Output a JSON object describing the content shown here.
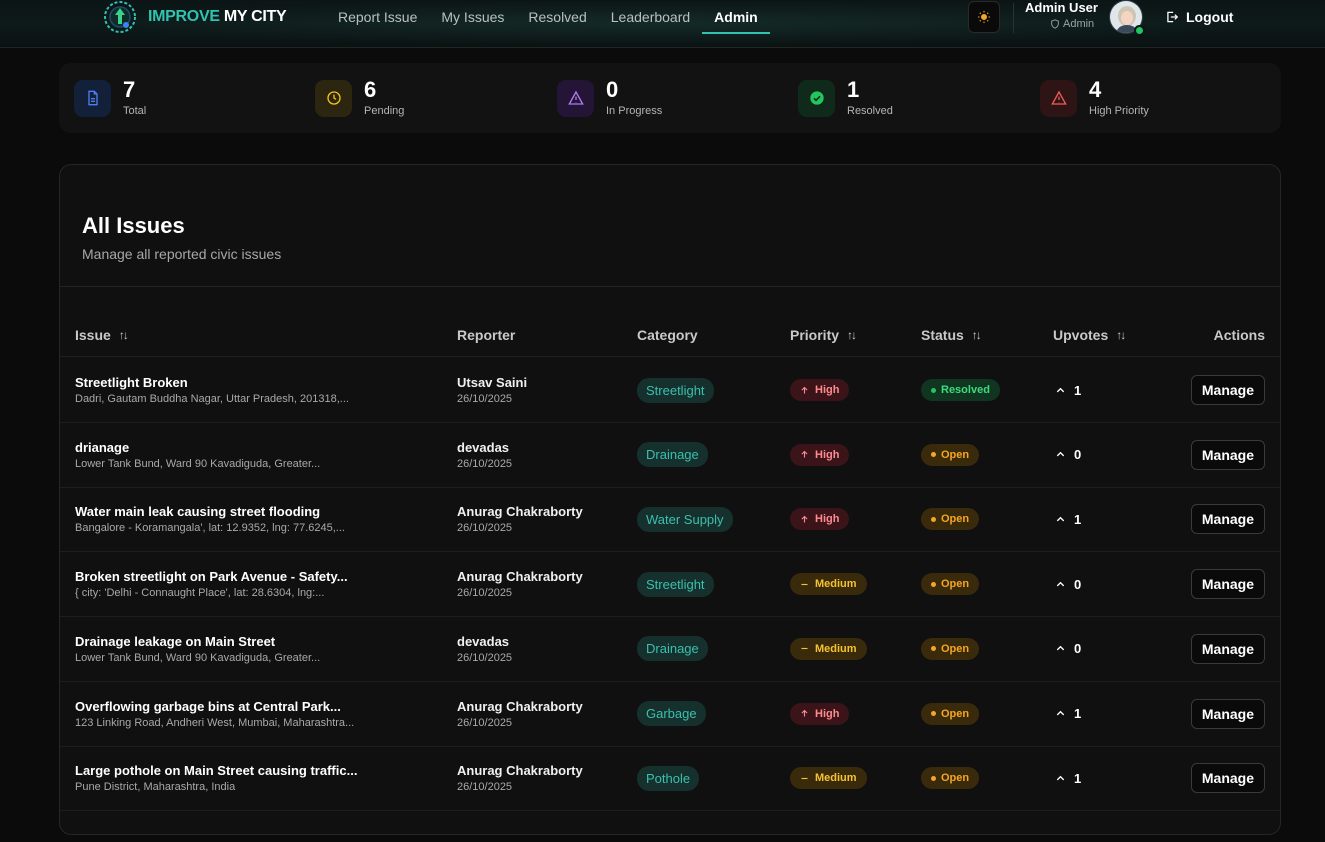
{
  "header": {
    "logo_part1": "IMPROVE",
    "logo_part2": " MY CITY",
    "nav": [
      {
        "label": "Report Issue"
      },
      {
        "label": "My Issues"
      },
      {
        "label": "Resolved"
      },
      {
        "label": "Leaderboard"
      },
      {
        "label": "Admin",
        "active": true
      }
    ],
    "theme_icon": "sun-icon",
    "user_name": "Admin User",
    "user_role": "Admin",
    "logout_label": "Logout"
  },
  "stats": [
    {
      "value": "7",
      "label": "Total",
      "icon": "document-icon",
      "color": "#4f7df0"
    },
    {
      "value": "6",
      "label": "Pending",
      "icon": "clock-icon",
      "color": "#f5c518"
    },
    {
      "value": "0",
      "label": "In Progress",
      "icon": "warning-triangle-icon",
      "color": "#b07cf0"
    },
    {
      "value": "1",
      "label": "Resolved",
      "icon": "check-circle-icon",
      "color": "#22c55e"
    },
    {
      "value": "4",
      "label": "High Priority",
      "icon": "alert-triangle-icon",
      "color": "#f05a5a"
    }
  ],
  "issues_card": {
    "title": "All Issues",
    "subtitle": "Manage all reported civic issues",
    "columns": [
      "Issue",
      "Reporter",
      "Category",
      "Priority",
      "Status",
      "Upvotes",
      "Actions"
    ],
    "manage_label": "Manage",
    "rows": [
      {
        "title": "Streetlight Broken",
        "location": "Dadri, Gautam Buddha Nagar, Uttar Pradesh, 201318,...",
        "reporter": "Utsav Saini",
        "date": "26/10/2025",
        "category": "Streetlight",
        "priority": "High",
        "status": "Resolved",
        "upvotes": "1"
      },
      {
        "title": "drianage",
        "location": "Lower Tank Bund, Ward 90 Kavadiguda, Greater...",
        "reporter": "devadas",
        "date": "26/10/2025",
        "category": "Drainage",
        "priority": "High",
        "status": "Open",
        "upvotes": "0"
      },
      {
        "title": "Water main leak causing street flooding",
        "location": "Bangalore - Koramangala', lat: 12.9352, lng: 77.6245,...",
        "reporter": "Anurag Chakraborty",
        "date": "26/10/2025",
        "category": "Water Supply",
        "priority": "High",
        "status": "Open",
        "upvotes": "1"
      },
      {
        "title": "Broken streetlight on Park Avenue - Safety...",
        "location": "{ city: 'Delhi - Connaught Place', lat: 28.6304, lng:...",
        "reporter": "Anurag Chakraborty",
        "date": "26/10/2025",
        "category": "Streetlight",
        "priority": "Medium",
        "status": "Open",
        "upvotes": "0"
      },
      {
        "title": "Drainage leakage on Main Street",
        "location": "Lower Tank Bund, Ward 90 Kavadiguda, Greater...",
        "reporter": "devadas",
        "date": "26/10/2025",
        "category": "Drainage",
        "priority": "Medium",
        "status": "Open",
        "upvotes": "0"
      },
      {
        "title": "Overflowing garbage bins at Central Park...",
        "location": "123 Linking Road, Andheri West, Mumbai, Maharashtra...",
        "reporter": "Anurag Chakraborty",
        "date": "26/10/2025",
        "category": "Garbage",
        "priority": "High",
        "status": "Open",
        "upvotes": "1"
      },
      {
        "title": "Large pothole on Main Street causing traffic...",
        "location": "Pune District, Maharashtra, India",
        "reporter": "Anurag Chakraborty",
        "date": "26/10/2025",
        "category": "Pothole",
        "priority": "Medium",
        "status": "Open",
        "upvotes": "1"
      }
    ]
  }
}
